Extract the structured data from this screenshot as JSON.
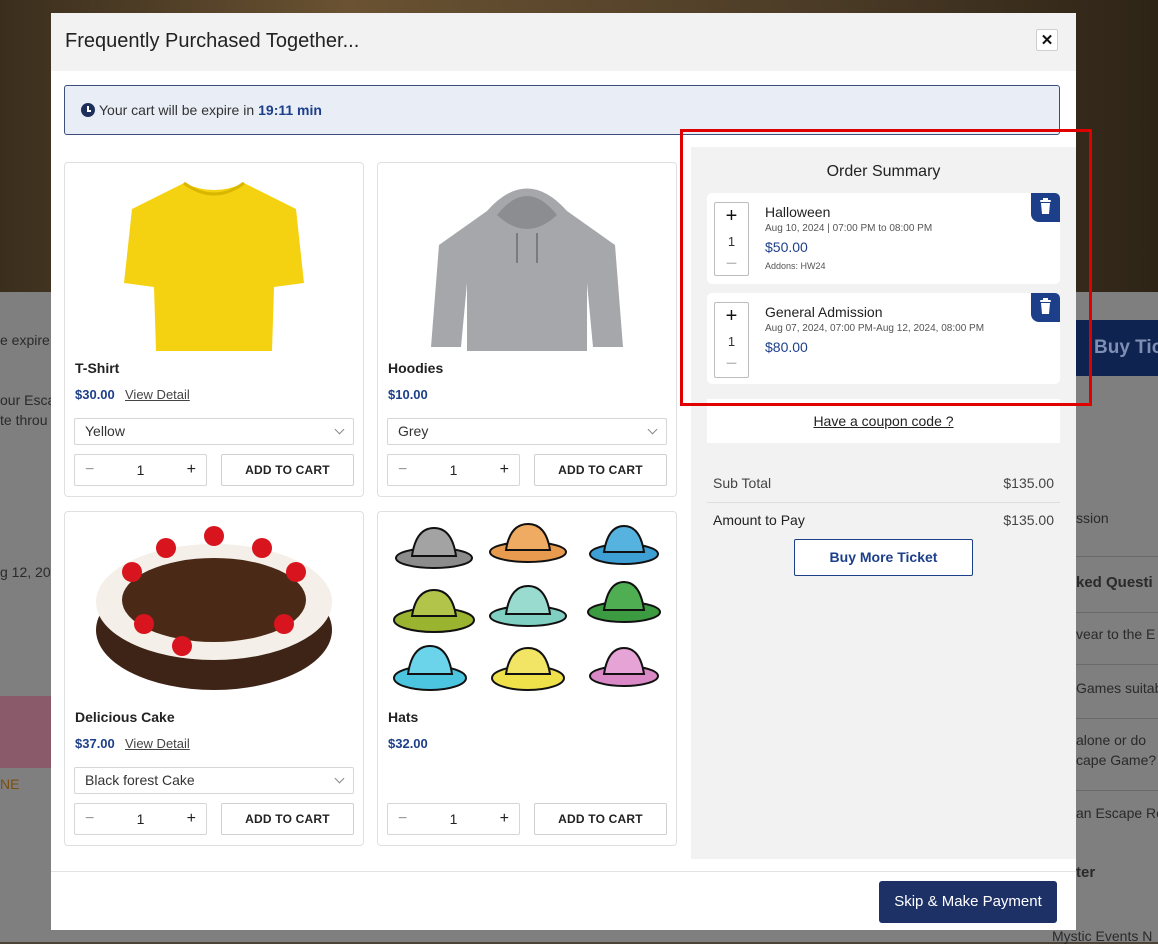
{
  "modal": {
    "title": "Frequently Purchased Together...",
    "close_label": "✕"
  },
  "timer": {
    "text": "Your cart will be expire in",
    "time": "19:11 min"
  },
  "products": [
    {
      "name": "T-Shirt",
      "price": "$30.00",
      "view_detail": "View Detail",
      "option": "Yellow",
      "qty": "1",
      "cta": "ADD TO CART"
    },
    {
      "name": "Hoodies",
      "price": "$10.00",
      "option": "Grey",
      "qty": "1",
      "cta": "ADD TO CART"
    },
    {
      "name": "Delicious Cake",
      "price": "$37.00",
      "view_detail": "View Detail",
      "option": "Black forest Cake",
      "qty": "1",
      "cta": "ADD TO CART"
    },
    {
      "name": "Hats",
      "price": "$32.00",
      "qty": "1",
      "cta": "ADD TO CART"
    }
  ],
  "order_summary": {
    "title": "Order Summary",
    "items": [
      {
        "name": "Halloween",
        "date": "Aug 10, 2024 | 07:00 PM to 08:00 PM",
        "price": "$50.00",
        "addons": "Addons: HW24",
        "qty": "1"
      },
      {
        "name": "General Admission",
        "date": "Aug 07, 2024, 07:00 PM-Aug 12, 2024, 08:00 PM",
        "price": "$80.00",
        "qty": "1"
      }
    ],
    "coupon_link": "Have a coupon code ?",
    "sub_total_label": "Sub Total",
    "sub_total": "$135.00",
    "amount_label": "Amount to Pay",
    "amount": "$135.00",
    "buy_more": "Buy More Ticket"
  },
  "footer": {
    "skip_button": "Skip & Make Payment"
  },
  "background": {
    "fragments": [
      "e expire",
      "our Esca",
      "te throu",
      "g 12, 20",
      "NE",
      "Buy Tic",
      "ssion",
      "ked Questi",
      "vear to the E",
      "Games suitab",
      "alone or do",
      "cape Game?",
      "an Escape Ro",
      "ter",
      "Mystic Events N"
    ]
  },
  "colors": {
    "accent": "#1d3f8a",
    "highlight": "#e00000",
    "skip_button": "#1d3167"
  },
  "icons": {
    "timer": "clock-icon",
    "delete": "trash-icon",
    "select": "chevron-down-icon"
  }
}
